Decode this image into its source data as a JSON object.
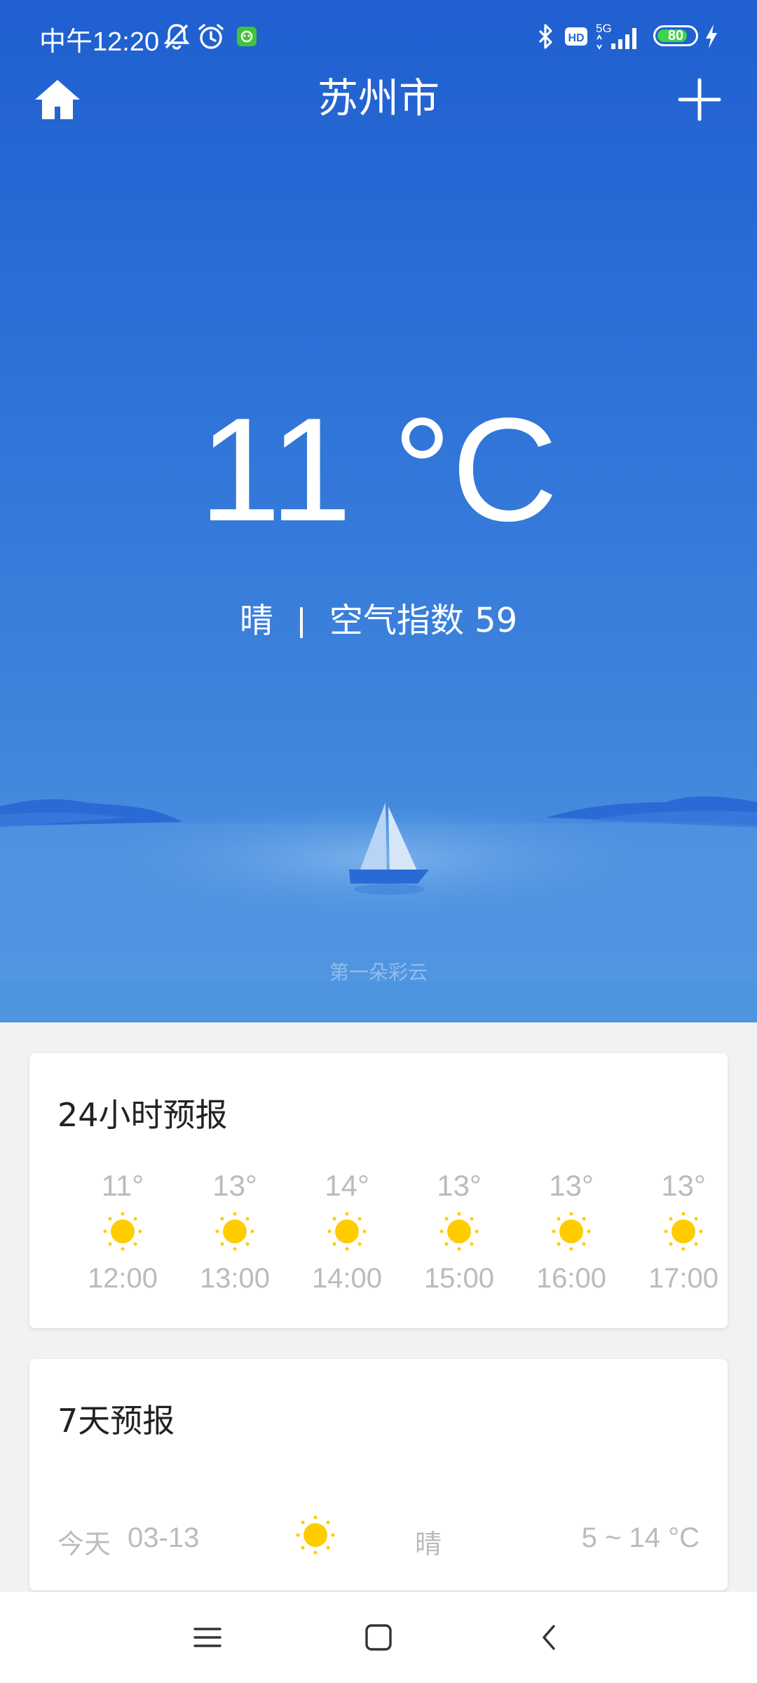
{
  "status_bar": {
    "time": "中午12:20",
    "battery": "80",
    "network": "5G",
    "hd": "HD",
    "battery_level": 0.8,
    "icons": [
      "bell-off-icon",
      "alarm-clock-icon",
      "app-notification-icon",
      "bluetooth-icon",
      "hd-icon",
      "signal-5g-icon",
      "battery-icon",
      "charging-icon"
    ]
  },
  "header": {
    "city": "苏州市",
    "home_icon": "home-icon",
    "add_icon": "plus-icon"
  },
  "current": {
    "temperature": "11 °C",
    "condition": "晴",
    "aqi_label": "空气指数 59"
  },
  "brand": "第一朵彩云",
  "forecast_24h": {
    "title": "24小时预报",
    "hours": [
      {
        "temp": "11°",
        "time": "12:00",
        "icon": "sun-icon"
      },
      {
        "temp": "13°",
        "time": "13:00",
        "icon": "sun-icon"
      },
      {
        "temp": "14°",
        "time": "14:00",
        "icon": "sun-icon"
      },
      {
        "temp": "13°",
        "time": "15:00",
        "icon": "sun-icon"
      },
      {
        "temp": "13°",
        "time": "16:00",
        "icon": "sun-icon"
      },
      {
        "temp": "13°",
        "time": "17:00",
        "icon": "sun-icon"
      }
    ]
  },
  "forecast_7d": {
    "title": "7天预报",
    "days": [
      {
        "day": "今天",
        "date": "03-13",
        "icon": "sun-icon",
        "condition": "晴",
        "range": "5 ~ 14 °C"
      }
    ]
  },
  "nav": {
    "icons": [
      "menu-icon",
      "home-square-icon",
      "back-icon"
    ]
  },
  "colors": {
    "sky_top": "#1f5fd0",
    "sky_bottom": "#4f96e0",
    "sun": "#ffcc00",
    "muted_text": "#bbbbbb"
  }
}
